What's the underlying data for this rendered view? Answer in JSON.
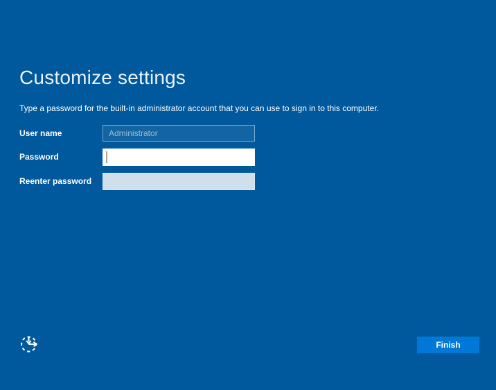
{
  "page": {
    "title": "Customize settings",
    "subtitle": "Type a password for the built-in administrator account that you can use to sign in to this computer."
  },
  "form": {
    "fields": [
      {
        "label": "User name",
        "value": "Administrator",
        "state": "disabled"
      },
      {
        "label": "Password",
        "value": "",
        "state": "focused"
      },
      {
        "label": "Reenter password",
        "value": "",
        "state": "disabled"
      }
    ]
  },
  "footer": {
    "finish_label": "Finish",
    "icons": [
      "ease-of-access-icon"
    ]
  },
  "colors": {
    "background": "#00599d",
    "button_accent": "#0078d7",
    "disabled_field": "#d0dfec",
    "active_field": "#ffffff",
    "title_text": "#e8f3fb",
    "label_text": "#ffffff"
  }
}
